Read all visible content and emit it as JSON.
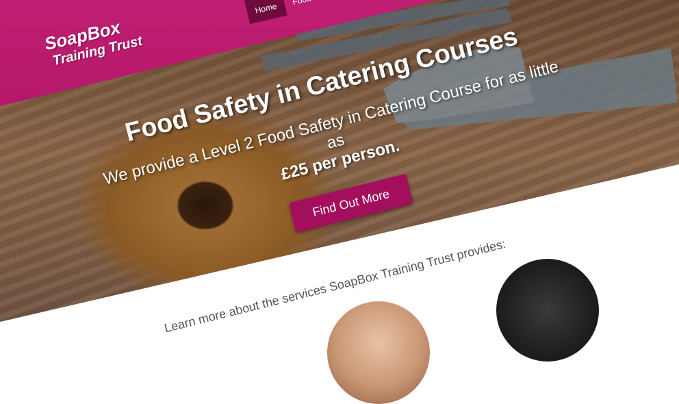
{
  "brand": {
    "line1": "SoapBox",
    "line2": "Training Trust"
  },
  "nav": [
    {
      "label": "Home",
      "active": true
    },
    {
      "label": "Food Safety",
      "active": false
    }
  ],
  "hero": {
    "title": "Food Safety in Catering Courses",
    "text": "We provide a Level 2 Food Safety in Catering Course for as little as",
    "price": "£25 per person.",
    "cta": "Find Out More"
  },
  "services": {
    "title": "SoapBox Training Trust provides:",
    "subtitle": "Learn more about the services SoapBox Training Trust provides:"
  },
  "colors": {
    "brand": "#a30f5c",
    "header": "#c01e72"
  }
}
